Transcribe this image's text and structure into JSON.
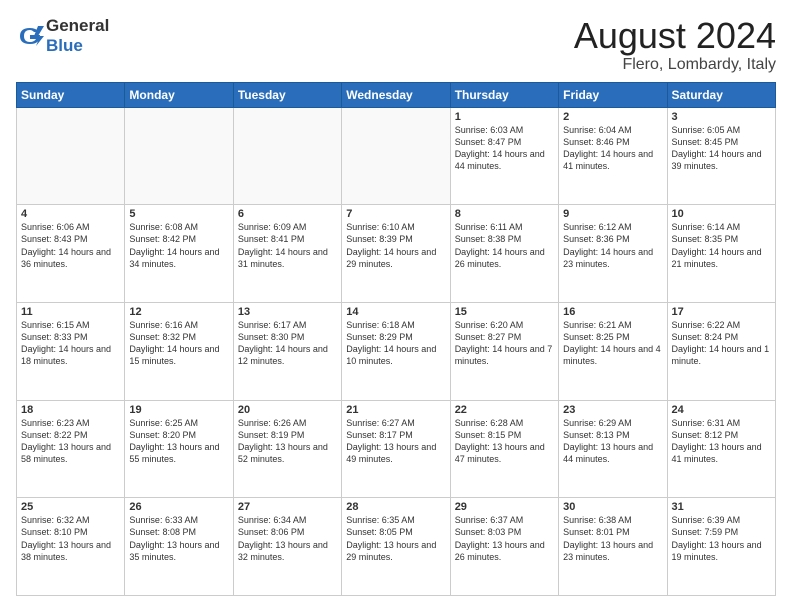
{
  "logo": {
    "general": "General",
    "blue": "Blue"
  },
  "header": {
    "month_year": "August 2024",
    "location": "Flero, Lombardy, Italy"
  },
  "days_of_week": [
    "Sunday",
    "Monday",
    "Tuesday",
    "Wednesday",
    "Thursday",
    "Friday",
    "Saturday"
  ],
  "weeks": [
    [
      {
        "day": "",
        "info": ""
      },
      {
        "day": "",
        "info": ""
      },
      {
        "day": "",
        "info": ""
      },
      {
        "day": "",
        "info": ""
      },
      {
        "day": "1",
        "info": "Sunrise: 6:03 AM\nSunset: 8:47 PM\nDaylight: 14 hours and 44 minutes."
      },
      {
        "day": "2",
        "info": "Sunrise: 6:04 AM\nSunset: 8:46 PM\nDaylight: 14 hours and 41 minutes."
      },
      {
        "day": "3",
        "info": "Sunrise: 6:05 AM\nSunset: 8:45 PM\nDaylight: 14 hours and 39 minutes."
      }
    ],
    [
      {
        "day": "4",
        "info": "Sunrise: 6:06 AM\nSunset: 8:43 PM\nDaylight: 14 hours and 36 minutes."
      },
      {
        "day": "5",
        "info": "Sunrise: 6:08 AM\nSunset: 8:42 PM\nDaylight: 14 hours and 34 minutes."
      },
      {
        "day": "6",
        "info": "Sunrise: 6:09 AM\nSunset: 8:41 PM\nDaylight: 14 hours and 31 minutes."
      },
      {
        "day": "7",
        "info": "Sunrise: 6:10 AM\nSunset: 8:39 PM\nDaylight: 14 hours and 29 minutes."
      },
      {
        "day": "8",
        "info": "Sunrise: 6:11 AM\nSunset: 8:38 PM\nDaylight: 14 hours and 26 minutes."
      },
      {
        "day": "9",
        "info": "Sunrise: 6:12 AM\nSunset: 8:36 PM\nDaylight: 14 hours and 23 minutes."
      },
      {
        "day": "10",
        "info": "Sunrise: 6:14 AM\nSunset: 8:35 PM\nDaylight: 14 hours and 21 minutes."
      }
    ],
    [
      {
        "day": "11",
        "info": "Sunrise: 6:15 AM\nSunset: 8:33 PM\nDaylight: 14 hours and 18 minutes."
      },
      {
        "day": "12",
        "info": "Sunrise: 6:16 AM\nSunset: 8:32 PM\nDaylight: 14 hours and 15 minutes."
      },
      {
        "day": "13",
        "info": "Sunrise: 6:17 AM\nSunset: 8:30 PM\nDaylight: 14 hours and 12 minutes."
      },
      {
        "day": "14",
        "info": "Sunrise: 6:18 AM\nSunset: 8:29 PM\nDaylight: 14 hours and 10 minutes."
      },
      {
        "day": "15",
        "info": "Sunrise: 6:20 AM\nSunset: 8:27 PM\nDaylight: 14 hours and 7 minutes."
      },
      {
        "day": "16",
        "info": "Sunrise: 6:21 AM\nSunset: 8:25 PM\nDaylight: 14 hours and 4 minutes."
      },
      {
        "day": "17",
        "info": "Sunrise: 6:22 AM\nSunset: 8:24 PM\nDaylight: 14 hours and 1 minute."
      }
    ],
    [
      {
        "day": "18",
        "info": "Sunrise: 6:23 AM\nSunset: 8:22 PM\nDaylight: 13 hours and 58 minutes."
      },
      {
        "day": "19",
        "info": "Sunrise: 6:25 AM\nSunset: 8:20 PM\nDaylight: 13 hours and 55 minutes."
      },
      {
        "day": "20",
        "info": "Sunrise: 6:26 AM\nSunset: 8:19 PM\nDaylight: 13 hours and 52 minutes."
      },
      {
        "day": "21",
        "info": "Sunrise: 6:27 AM\nSunset: 8:17 PM\nDaylight: 13 hours and 49 minutes."
      },
      {
        "day": "22",
        "info": "Sunrise: 6:28 AM\nSunset: 8:15 PM\nDaylight: 13 hours and 47 minutes."
      },
      {
        "day": "23",
        "info": "Sunrise: 6:29 AM\nSunset: 8:13 PM\nDaylight: 13 hours and 44 minutes."
      },
      {
        "day": "24",
        "info": "Sunrise: 6:31 AM\nSunset: 8:12 PM\nDaylight: 13 hours and 41 minutes."
      }
    ],
    [
      {
        "day": "25",
        "info": "Sunrise: 6:32 AM\nSunset: 8:10 PM\nDaylight: 13 hours and 38 minutes."
      },
      {
        "day": "26",
        "info": "Sunrise: 6:33 AM\nSunset: 8:08 PM\nDaylight: 13 hours and 35 minutes."
      },
      {
        "day": "27",
        "info": "Sunrise: 6:34 AM\nSunset: 8:06 PM\nDaylight: 13 hours and 32 minutes."
      },
      {
        "day": "28",
        "info": "Sunrise: 6:35 AM\nSunset: 8:05 PM\nDaylight: 13 hours and 29 minutes."
      },
      {
        "day": "29",
        "info": "Sunrise: 6:37 AM\nSunset: 8:03 PM\nDaylight: 13 hours and 26 minutes."
      },
      {
        "day": "30",
        "info": "Sunrise: 6:38 AM\nSunset: 8:01 PM\nDaylight: 13 hours and 23 minutes."
      },
      {
        "day": "31",
        "info": "Sunrise: 6:39 AM\nSunset: 7:59 PM\nDaylight: 13 hours and 19 minutes."
      }
    ]
  ]
}
